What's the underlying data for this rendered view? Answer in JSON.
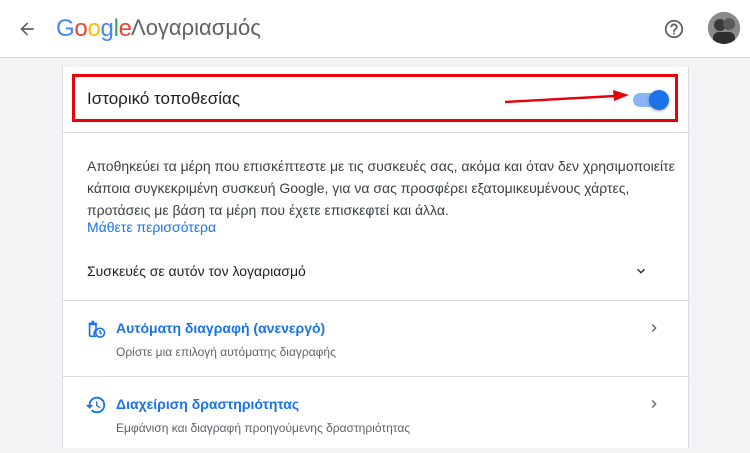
{
  "topbar": {
    "logo": {
      "letters": [
        {
          "ch": "G",
          "cls": "g-blue"
        },
        {
          "ch": "o",
          "cls": "g-red"
        },
        {
          "ch": "o",
          "cls": "g-yellow"
        },
        {
          "ch": "g",
          "cls": "g-blue"
        },
        {
          "ch": "l",
          "cls": "g-green"
        },
        {
          "ch": "e",
          "cls": "g-red"
        }
      ]
    },
    "app_name": "Λογαριασμός",
    "icons": {
      "back": "arrow-back-icon",
      "help": "help-circle-icon",
      "avatar": "account-avatar"
    }
  },
  "location_history": {
    "title": "Ιστορικό τοποθεσίας",
    "toggle_on": true,
    "description": "Αποθηκεύει τα μέρη που επισκέπτεστε με τις συσκευές σας, ακόμα και όταν δεν χρησιμοποιείτε κάποια συγκεκριμένη συσκευή Google, για να σας προσφέρει εξατομικευμένους χάρτες, προτάσεις με βάση τα μέρη που έχετε επισκεφτεί και άλλα.",
    "learn_more": "Μάθετε περισσότερα"
  },
  "devices": {
    "label": "Συσκευές σε αυτόν τον λογαριασμό"
  },
  "rows": [
    {
      "title": "Αυτόματη διαγραφή (ανενεργό)",
      "subtitle": "Ορίστε μια επιλογή αυτόματης διαγραφής",
      "icon": "auto-delete-icon"
    },
    {
      "title": "Διαχείριση δραστηριότητας",
      "subtitle": "Εμφάνιση και διαγραφή προηγούμενης δραστηριότητας",
      "icon": "history-icon"
    }
  ],
  "colors": {
    "accent": "#1a73e8",
    "highlight": "#e8000b",
    "background": "#f1f3f4"
  }
}
